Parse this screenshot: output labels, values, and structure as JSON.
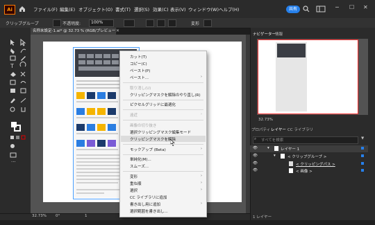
{
  "menubar": {
    "logo": "Ai",
    "items": [
      "ファイル(F)",
      "編集(E)",
      "オブジェクト(O)",
      "書式(T)",
      "選択(S)",
      "効果(C)",
      "表示(V)",
      "ウィンドウ(W)",
      "ヘルプ(H)"
    ],
    "share": "共有"
  },
  "control_bar": {
    "selection_label": "クリップグループ",
    "opacity_label": "不透明度:",
    "opacity_value": "100%",
    "transform_label": "変形"
  },
  "document_tab": {
    "title": "名称未設定-1.ai* @ 32.73 % (RGB/プレビュー)"
  },
  "status": {
    "zoom": "32.73%",
    "angle": "0°",
    "artboard": "1"
  },
  "context_menu": {
    "items": [
      {
        "label": "カット(T)",
        "disabled": false
      },
      {
        "label": "コピー(C)",
        "disabled": false
      },
      {
        "label": "ペースト(P)",
        "disabled": false
      },
      {
        "label": "ペースト...",
        "disabled": false
      },
      {
        "label": "取り消し(U)",
        "disabled": true
      },
      {
        "label": "クリッピングマスクを解除のやり直し(R)",
        "disabled": false
      },
      {
        "label": "ピクセルグリッドに最適化",
        "disabled": false
      },
      {
        "label": "遠近",
        "disabled": true
      },
      {
        "label": "画像の切り抜き",
        "disabled": true
      },
      {
        "label": "選択クリッピングマスク編集モード",
        "disabled": false
      },
      {
        "label": "クリッピングマスクを解除",
        "disabled": false
      },
      {
        "label": "モックアップ (Beta)",
        "disabled": false
      },
      {
        "label": "単純化(M)...",
        "disabled": false
      },
      {
        "label": "スムーズ...",
        "disabled": false
      },
      {
        "label": "変形",
        "disabled": false
      },
      {
        "label": "重ね順",
        "disabled": false
      },
      {
        "label": "選択",
        "disabled": false
      },
      {
        "label": "CC ライブラリに追加",
        "disabled": false
      },
      {
        "label": "書き出し用に追加",
        "disabled": false
      },
      {
        "label": "選択範囲を書き出し...",
        "disabled": false
      }
    ]
  },
  "navigator": {
    "tab_nav": "ナビゲーター",
    "tab_info": "情報",
    "zoom": "32.73%"
  },
  "layers_panel": {
    "tabs": [
      "プロパティ",
      "レイヤー",
      "CC ライブラリ"
    ],
    "search_placeholder": "すべてを検索",
    "rows": [
      "レイヤー 1",
      "< クリップグループ >",
      "< クリッピングパス >",
      "< 画像 >"
    ],
    "footer": "1 レイヤー"
  }
}
